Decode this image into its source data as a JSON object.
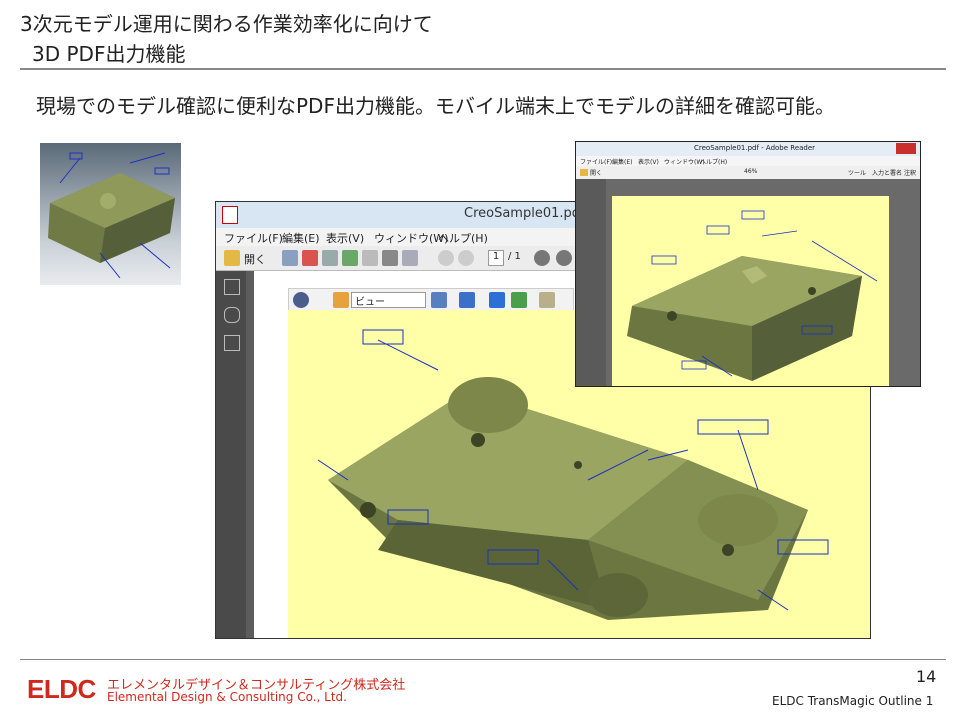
{
  "slide": {
    "title_line1": "3次元モデル運用に関わる作業効率化に向けて",
    "title_line2": "3D PDF出力機能",
    "subtitle": "現場でのモデル確認に便利なPDF出力機能。モバイル端末上でモデルの詳細を確認可能。",
    "page_number": "14",
    "footer": "ELDC TransMagic Outline 1"
  },
  "company": {
    "logo": "ELDC",
    "name_jp": "エレメンタルデザイン＆コンサルティング株式会社",
    "name_en": "Elemental Design & Consulting Co., Ltd."
  },
  "main_window": {
    "title": "CreoSample01.pdf",
    "menu": [
      "ファイル(F)",
      "編集(E)",
      "表示(V)",
      "ウィンドウ(W)",
      "ヘルプ(H)"
    ],
    "open_label": "開く",
    "page_current": "1",
    "page_total": "/ 1",
    "view_select": "ビュー"
  },
  "small_window": {
    "title": "CreoSample01.pdf - Adobe Reader",
    "menu": [
      "ファイル(F)",
      "編集(E)",
      "表示(V)",
      "ウィンドウ(W)",
      "ヘルプ(H)"
    ],
    "open_label": "開く",
    "zoom": "46%",
    "tools": [
      "ツール",
      "入力と署名",
      "注釈"
    ]
  },
  "colors": {
    "brand": "#d0281c",
    "canvas": "#ffffa8",
    "model": "#8f9a5a"
  }
}
